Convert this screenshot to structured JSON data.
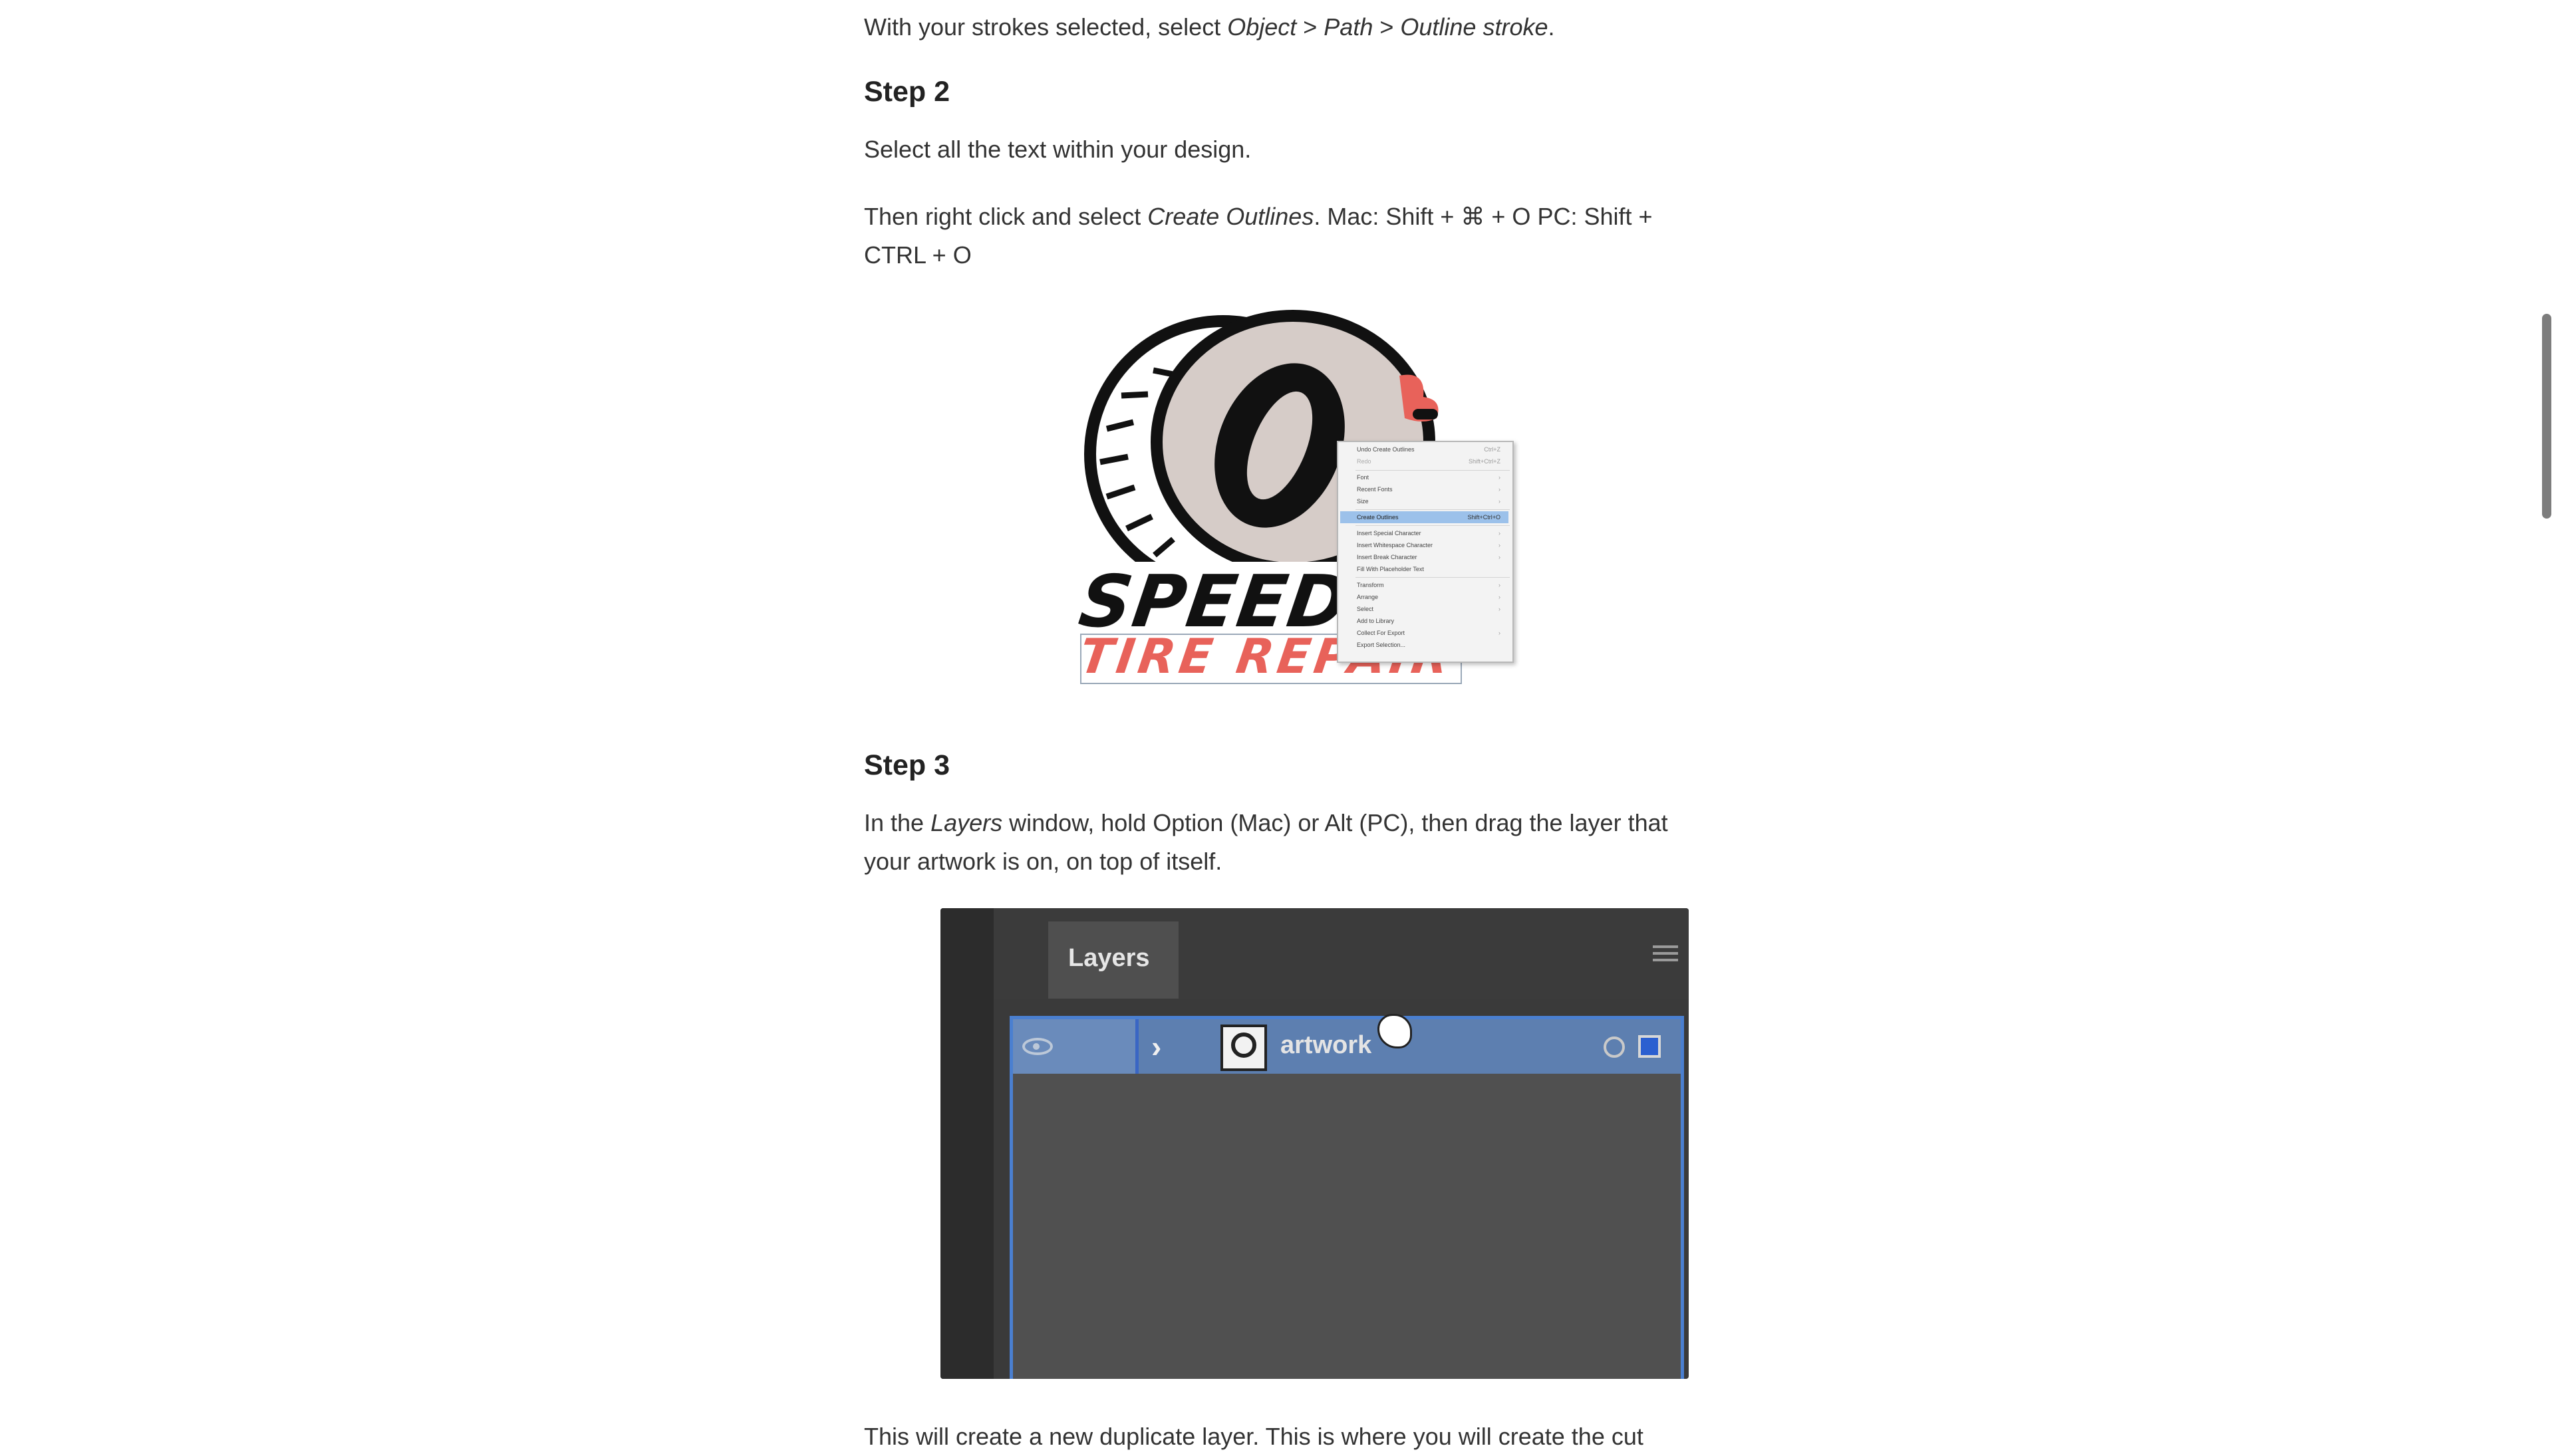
{
  "step1": {
    "tail_prefix": "With your strokes selected, select ",
    "menu_object": "Object",
    "sep1": " > ",
    "menu_path": "Path",
    "sep2": " > ",
    "menu_outline": "Outline stroke",
    "tail_suffix": "."
  },
  "step2": {
    "heading": "Step 2",
    "para1": "Select all the text within your design.",
    "para2_prefix": "Then right click and select ",
    "para2_em": "Create Outlines",
    "para2_suffix": ". Mac: Shift + ⌘ + O PC: Shift + CTRL + O",
    "figure": {
      "logo_word1": "SPEED",
      "logo_word2": "TIRE REPAIR",
      "colors": {
        "logo_red": "#e8625a",
        "tire_face": "#d6ccc8",
        "outline": "#111111",
        "menu_highlight": "#9cc1ea"
      },
      "context_menu": [
        {
          "label": "Undo Create Outlines",
          "shortcut": "Ctrl+Z"
        },
        {
          "label": "Redo",
          "shortcut": "Shift+Ctrl+Z",
          "disabled": true
        },
        {
          "separator": true
        },
        {
          "label": "Font",
          "shortcut": "›"
        },
        {
          "label": "Recent Fonts",
          "shortcut": "›"
        },
        {
          "label": "Size",
          "shortcut": "›"
        },
        {
          "separator": true
        },
        {
          "label": "Create Outlines",
          "shortcut": "Shift+Ctrl+O",
          "highlighted": true
        },
        {
          "separator": true
        },
        {
          "label": "Insert Special Character",
          "shortcut": "›"
        },
        {
          "label": "Insert Whitespace Character",
          "shortcut": "›"
        },
        {
          "label": "Insert Break Character",
          "shortcut": "›"
        },
        {
          "label": "Fill With Placeholder Text",
          "shortcut": ""
        },
        {
          "separator": true
        },
        {
          "label": "Transform",
          "shortcut": "›"
        },
        {
          "label": "Arrange",
          "shortcut": "›"
        },
        {
          "label": "Select",
          "shortcut": "›"
        },
        {
          "label": "Add to Library",
          "shortcut": ""
        },
        {
          "label": "Collect For Export",
          "shortcut": "›"
        },
        {
          "label": "Export Selection...",
          "shortcut": ""
        }
      ]
    }
  },
  "step3": {
    "heading": "Step 3",
    "para_prefix": "In the ",
    "para_em": "Layers",
    "para_suffix": " window, hold Option (Mac) or Alt (PC), then drag the layer that your artwork is on, on top of itself.",
    "panel": {
      "tab_label": "Layers",
      "layer_name": "artwork",
      "icons": [
        "eye-icon",
        "chevron-right-icon",
        "target-circle-icon",
        "selection-square-icon",
        "panel-menu-icon"
      ],
      "colors": {
        "panel_bg": "#3a3a3a",
        "row_bg": "#5d7fb0",
        "row_border": "#4a7fd0",
        "selection_square": "#2b5fd0"
      }
    },
    "next_para": "This will create a new duplicate layer. This is where you will create the cut"
  }
}
